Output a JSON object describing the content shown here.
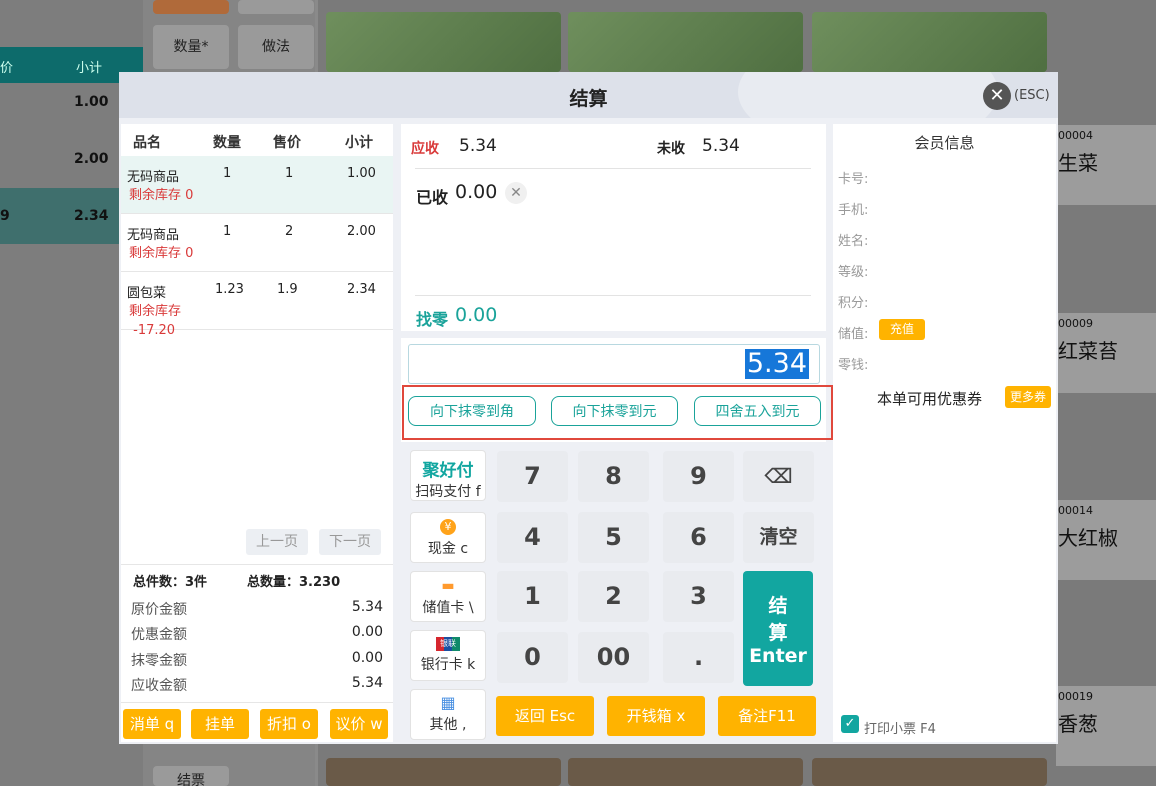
{
  "background": {
    "table_headers": [
      "价",
      "小计"
    ],
    "rows": [
      {
        "left": "",
        "subtotal": "1.00"
      },
      {
        "left": "",
        "subtotal": "2.00"
      },
      {
        "left": "9",
        "subtotal": "2.34"
      }
    ],
    "side_buttons": [
      "数量*",
      "做法",
      "结票"
    ],
    "product_cards": [
      {
        "code": "00004",
        "name": "生菜"
      },
      {
        "code": "00009",
        "name": "红菜苔"
      },
      {
        "code": "00014",
        "name": "大红椒"
      },
      {
        "code": "00019",
        "name": "香葱"
      }
    ]
  },
  "modal": {
    "title": "结算",
    "close_hint": "(ESC)",
    "left": {
      "headers": {
        "name": "品名",
        "qty": "数量",
        "price": "售价",
        "subtotal": "小计"
      },
      "items": [
        {
          "name": "无码商品",
          "qty": "1",
          "price": "1",
          "subtotal": "1.00",
          "stock_label": "剩余库存",
          "stock": "0"
        },
        {
          "name": "无码商品",
          "qty": "1",
          "price": "2",
          "subtotal": "2.00",
          "stock_label": "剩余库存",
          "stock": "0"
        },
        {
          "name": "圆包菜",
          "qty": "1.23",
          "price": "1.9",
          "subtotal": "2.34",
          "stock_label": "剩余库存",
          "stock": "-17.20"
        }
      ],
      "prev_page": "上一页",
      "next_page": "下一页",
      "total_count_label": "总件数：",
      "total_count": "3件",
      "total_qty_label": "总数量：",
      "total_qty": "3.230",
      "amounts": [
        {
          "label": "原价金额",
          "value": "5.34"
        },
        {
          "label": "优惠金额",
          "value": "0.00"
        },
        {
          "label": "抹零金额",
          "value": "0.00"
        },
        {
          "label": "应收金额",
          "value": "5.34"
        }
      ],
      "actions": [
        "消单 q",
        "挂单",
        "折扣 o",
        "议价 w"
      ]
    },
    "center": {
      "receivable_label": "应收",
      "receivable": "5.34",
      "unpaid_label": "未收",
      "unpaid": "5.34",
      "received_label": "已收",
      "received": "0.00",
      "change_label": "找零",
      "change": "0.00",
      "input_value": "5.34",
      "round_buttons": [
        "向下抹零到角",
        "向下抹零到元",
        "四舍五入到元"
      ],
      "payments": [
        {
          "brand": "聚好付",
          "label": "扫码支付 f"
        },
        {
          "icon": "¥",
          "label": "现金 c"
        },
        {
          "icon": "▬",
          "label": "储值卡 \\"
        },
        {
          "icon": "银联",
          "label": "银行卡 k"
        },
        {
          "icon": "▦",
          "label": "其他 ,"
        }
      ],
      "keys": [
        "7",
        "8",
        "9",
        "⌫",
        "4",
        "5",
        "6",
        "清空",
        "1",
        "2",
        "3",
        "0",
        "00",
        "."
      ],
      "enter_label_1": "结",
      "enter_label_2": "算",
      "enter_label_3": "Enter",
      "bottom_buttons": [
        "返回 Esc",
        "开钱箱 x",
        "备注F11"
      ]
    },
    "right": {
      "title": "会员信息",
      "fields": [
        "卡号:",
        "手机:",
        "姓名:",
        "等级:",
        "积分:",
        "储值:",
        "零钱:"
      ],
      "recharge": "充值",
      "coupon_label": "本单可用优惠券",
      "coupon_more": "更多券",
      "print_label": "打印小票 F4"
    }
  },
  "colors": {
    "teal": "#12a6a0",
    "amber": "#ffb300",
    "red": "#d93a3a"
  }
}
